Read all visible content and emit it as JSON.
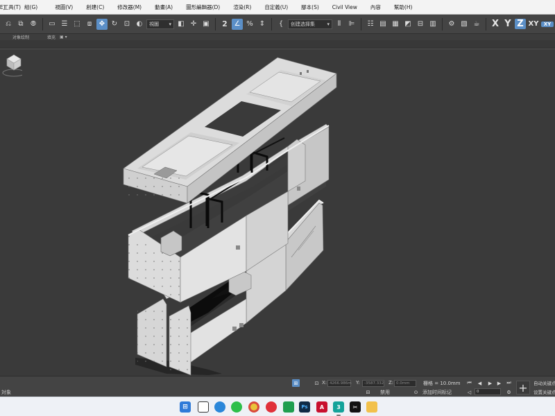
{
  "menubar": {
    "items": [
      "編輯(E)",
      "工具(T)",
      "組(G)",
      "視圖(V)",
      "創建(C)",
      "修改器(M)",
      "動畫(A)",
      "圖形編輯器(D)",
      "渲染(R)",
      "自定義(U)",
      "腳本(S)",
      "Civil View",
      "內容",
      "幫助(H)"
    ]
  },
  "toolbar": {
    "selection_filter": "視圖",
    "named_selection": "创建选择集",
    "axes": [
      "X",
      "Y",
      "Z",
      "XY",
      "XY"
    ],
    "icons": [
      "undo-icon",
      "redo-icon",
      "link-icon",
      "unlink-icon",
      "bind-spacewarp-icon",
      "select-icon",
      "select-by-name-icon",
      "rect-selection-icon",
      "window-crossing-icon",
      "move-icon",
      "rotate-icon",
      "scale-icon",
      "placement-icon",
      "reference-coord-dropdown",
      "pivot-icon",
      "snap-toggle-icon",
      "angle-snap-icon",
      "percent-snap-icon",
      "spinner-snap-icon",
      "named-selection-set-icon",
      "mirror-icon",
      "align-icon",
      "toggle-scene-explorer-icon",
      "toggle-layer-explorer-icon",
      "graphite-toolbar-icon",
      "curve-editor-icon",
      "schematic-view-icon",
      "material-editor-icon",
      "render-setup-icon",
      "rendered-frame-icon",
      "render-icon"
    ]
  },
  "ribbon": {
    "tabs": [
      "对象绘制",
      "填充"
    ]
  },
  "status": {
    "selection_text": "対象",
    "x_field": "4266.986m",
    "y_field": "-3587.332",
    "z_field": "0.0mm",
    "grid": "栅格 = 10.0mm",
    "disabled_label": "禁用",
    "add_time_tag": "添加时间标记",
    "frame": "0",
    "auto_key": "自动关键点",
    "set_key": "设置关键点"
  },
  "colors": {
    "menubar_bg": "#f3f3f3",
    "toolbar_bg": "#444444",
    "viewport_bg": "#3a3a3a",
    "accent": "#5b8fc7",
    "taskbar_bg": "#eef1f6"
  },
  "taskbar": {
    "apps": [
      "windows-start-icon",
      "file-explorer-icon",
      "edge-icon",
      "wechat-icon",
      "chrome-icon",
      "netease-music-icon",
      "green-app-icon",
      "photoshop-icon",
      "acrobat-icon",
      "3dsmax-icon",
      "capcut-icon",
      "folder-icon"
    ]
  }
}
